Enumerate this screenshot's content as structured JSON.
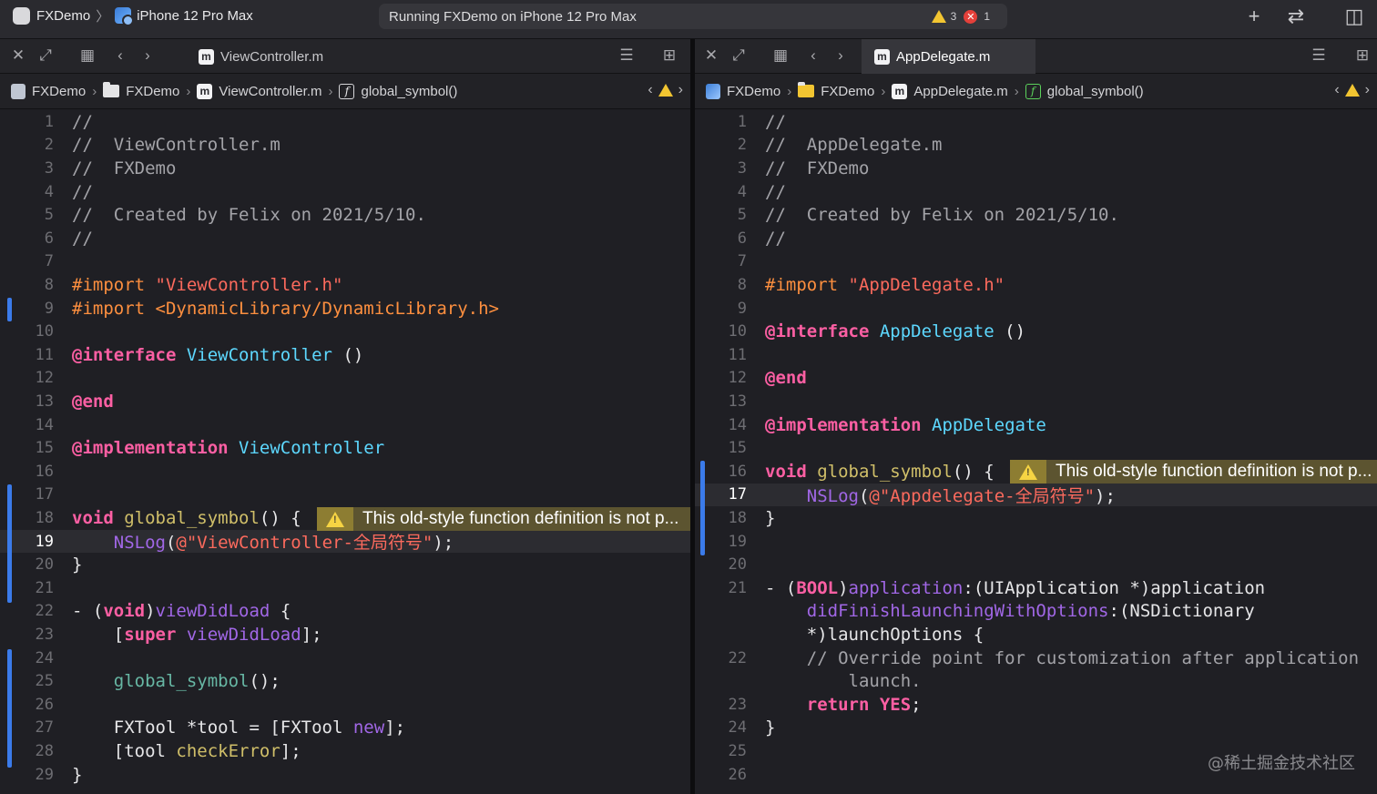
{
  "toolbar": {
    "app_name": "FXDemo",
    "device": "iPhone 12 Pro Max",
    "status": "Running FXDemo on iPhone 12 Pro Max",
    "warning_count": "3",
    "error_count": "1",
    "error_glyph": "✕",
    "add_glyph": "+",
    "swap_glyph": "⇄",
    "inspector_glyph": "◫"
  },
  "left_pane": {
    "tab": {
      "label": "ViewController.m",
      "icon": "m"
    },
    "breadcrumb": [
      "FXDemo",
      "FXDemo",
      "ViewController.m",
      "global_symbol()"
    ],
    "issue_message": "This old-style function definition is not p...",
    "current_line": 19
  },
  "right_pane": {
    "tab": {
      "label": "AppDelegate.m",
      "icon": "m"
    },
    "breadcrumb": [
      "FXDemo",
      "FXDemo",
      "AppDelegate.m",
      "global_symbol()"
    ],
    "issue_message": "This old-style function definition is not p...",
    "current_line": 17
  },
  "code_left": [
    {
      "n": "1",
      "t": [
        [
          "c-com",
          "//"
        ]
      ]
    },
    {
      "n": "2",
      "t": [
        [
          "c-com",
          "//  ViewController.m"
        ]
      ]
    },
    {
      "n": "3",
      "t": [
        [
          "c-com",
          "//  FXDemo"
        ]
      ]
    },
    {
      "n": "4",
      "t": [
        [
          "c-com",
          "//"
        ]
      ]
    },
    {
      "n": "5",
      "t": [
        [
          "c-com",
          "//  Created by Felix on 2021/5/10."
        ]
      ]
    },
    {
      "n": "6",
      "t": [
        [
          "c-com",
          "//"
        ]
      ]
    },
    {
      "n": "7",
      "t": []
    },
    {
      "n": "8",
      "t": [
        [
          "c-pp",
          "#import "
        ],
        [
          "c-str",
          "\"ViewController.h\""
        ]
      ]
    },
    {
      "n": "9",
      "t": [
        [
          "c-pp",
          "#import <DynamicLibrary/DynamicLibrary.h>"
        ]
      ]
    },
    {
      "n": "10",
      "t": []
    },
    {
      "n": "11",
      "t": [
        [
          "c-kw",
          "@interface "
        ],
        [
          "c-cls",
          "ViewController"
        ],
        [
          "c-pl",
          " ()"
        ]
      ]
    },
    {
      "n": "12",
      "t": []
    },
    {
      "n": "13",
      "t": [
        [
          "c-kw",
          "@end"
        ]
      ]
    },
    {
      "n": "14",
      "t": []
    },
    {
      "n": "15",
      "t": [
        [
          "c-kw",
          "@implementation "
        ],
        [
          "c-cls",
          "ViewController"
        ]
      ]
    },
    {
      "n": "16",
      "t": []
    },
    {
      "n": "17",
      "t": []
    },
    {
      "n": "18",
      "t": [
        [
          "c-kw",
          "void "
        ],
        [
          "c-ivar",
          "global_symbol"
        ],
        [
          "c-pl",
          "() {"
        ]
      ]
    },
    {
      "n": "19",
      "t": [
        [
          "c-pl",
          "    "
        ],
        [
          "c-fn",
          "NSLog"
        ],
        [
          "c-pl",
          "("
        ],
        [
          "c-str",
          "@\"ViewController-全局符号\""
        ],
        [
          "c-pl",
          ");"
        ]
      ]
    },
    {
      "n": "20",
      "t": [
        [
          "c-pl",
          "}"
        ]
      ]
    },
    {
      "n": "21",
      "t": []
    },
    {
      "n": "22",
      "t": [
        [
          "c-pl",
          "- ("
        ],
        [
          "c-kw",
          "void"
        ],
        [
          "c-pl",
          ")"
        ],
        [
          "c-fn",
          "viewDidLoad"
        ],
        [
          "c-pl",
          " {"
        ]
      ]
    },
    {
      "n": "23",
      "t": [
        [
          "c-pl",
          "    ["
        ],
        [
          "c-kw",
          "super "
        ],
        [
          "c-fn",
          "viewDidLoad"
        ],
        [
          "c-pl",
          "];"
        ]
      ]
    },
    {
      "n": "24",
      "t": []
    },
    {
      "n": "25",
      "t": [
        [
          "c-pl",
          "    "
        ],
        [
          "c-meth",
          "global_symbol"
        ],
        [
          "c-pl",
          "();"
        ]
      ]
    },
    {
      "n": "26",
      "t": []
    },
    {
      "n": "27",
      "t": [
        [
          "c-pl",
          "    FXTool *tool = [FXTool "
        ],
        [
          "c-fn",
          "new"
        ],
        [
          "c-pl",
          "];"
        ]
      ]
    },
    {
      "n": "28",
      "t": [
        [
          "c-pl",
          "    [tool "
        ],
        [
          "c-ivar",
          "checkError"
        ],
        [
          "c-pl",
          "];"
        ]
      ]
    },
    {
      "n": "29",
      "t": [
        [
          "c-pl",
          "}"
        ]
      ]
    }
  ],
  "code_right": [
    {
      "n": "1",
      "t": [
        [
          "c-com",
          "//"
        ]
      ]
    },
    {
      "n": "2",
      "t": [
        [
          "c-com",
          "//  AppDelegate.m"
        ]
      ]
    },
    {
      "n": "3",
      "t": [
        [
          "c-com",
          "//  FXDemo"
        ]
      ]
    },
    {
      "n": "4",
      "t": [
        [
          "c-com",
          "//"
        ]
      ]
    },
    {
      "n": "5",
      "t": [
        [
          "c-com",
          "//  Created by Felix on 2021/5/10."
        ]
      ]
    },
    {
      "n": "6",
      "t": [
        [
          "c-com",
          "//"
        ]
      ]
    },
    {
      "n": "7",
      "t": []
    },
    {
      "n": "8",
      "t": [
        [
          "c-pp",
          "#import "
        ],
        [
          "c-str",
          "\"AppDelegate.h\""
        ]
      ]
    },
    {
      "n": "9",
      "t": []
    },
    {
      "n": "10",
      "t": [
        [
          "c-kw",
          "@interface "
        ],
        [
          "c-cls",
          "AppDelegate"
        ],
        [
          "c-pl",
          " ()"
        ]
      ]
    },
    {
      "n": "11",
      "t": []
    },
    {
      "n": "12",
      "t": [
        [
          "c-kw",
          "@end"
        ]
      ]
    },
    {
      "n": "13",
      "t": []
    },
    {
      "n": "14",
      "t": [
        [
          "c-kw",
          "@implementation "
        ],
        [
          "c-cls",
          "AppDelegate"
        ]
      ]
    },
    {
      "n": "15",
      "t": []
    },
    {
      "n": "16",
      "t": [
        [
          "c-kw",
          "void "
        ],
        [
          "c-ivar",
          "global_symbol"
        ],
        [
          "c-pl",
          "() {"
        ]
      ]
    },
    {
      "n": "17",
      "t": [
        [
          "c-pl",
          "    "
        ],
        [
          "c-fn",
          "NSLog"
        ],
        [
          "c-pl",
          "("
        ],
        [
          "c-str",
          "@\"Appdelegate-全局符号\""
        ],
        [
          "c-pl",
          ");"
        ]
      ]
    },
    {
      "n": "18",
      "t": [
        [
          "c-pl",
          "}"
        ]
      ]
    },
    {
      "n": "19",
      "t": []
    },
    {
      "n": "20",
      "t": []
    },
    {
      "n": "21",
      "t": [
        [
          "c-pl",
          "- ("
        ],
        [
          "c-kw",
          "BOOL"
        ],
        [
          "c-pl",
          ")"
        ],
        [
          "c-fn",
          "application"
        ],
        [
          "c-pl",
          ":(UIApplication *)application"
        ]
      ]
    },
    {
      "n": "",
      "t": [
        [
          "c-pl",
          "    "
        ],
        [
          "c-fn",
          "didFinishLaunchingWithOptions"
        ],
        [
          "c-pl",
          ":(NSDictionary"
        ]
      ]
    },
    {
      "n": "",
      "t": [
        [
          "c-pl",
          "    *)launchOptions {"
        ]
      ]
    },
    {
      "n": "22",
      "t": [
        [
          "c-com",
          "    // Override point for customization after application"
        ]
      ]
    },
    {
      "n": "",
      "t": [
        [
          "c-com",
          "        launch."
        ]
      ]
    },
    {
      "n": "23",
      "t": [
        [
          "c-pl",
          "    "
        ],
        [
          "c-kw",
          "return YES"
        ],
        [
          "c-pl",
          ";"
        ]
      ]
    },
    {
      "n": "24",
      "t": [
        [
          "c-pl",
          "}"
        ]
      ]
    },
    {
      "n": "25",
      "t": []
    },
    {
      "n": "26",
      "t": []
    }
  ],
  "watermark": "@稀土掘金技术社区"
}
